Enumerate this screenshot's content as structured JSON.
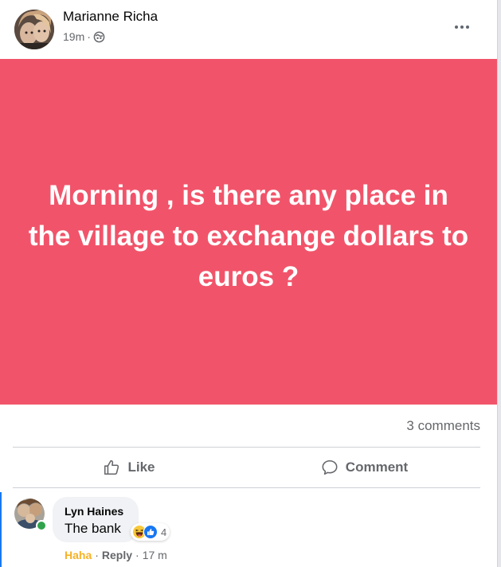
{
  "post": {
    "author": "Marianne Richa",
    "time": "19m",
    "separator": "·",
    "audience_icon": "globe-icon",
    "more_icon": "more-options-icon",
    "background_color": "#f1546a",
    "text": "Morning , is there any place in the village to exchange dollars to euros ?"
  },
  "stats": {
    "comments": "3 comments"
  },
  "actions": {
    "like_label": "Like",
    "like_icon": "thumbs-up-icon",
    "comment_label": "Comment",
    "comment_icon": "speech-bubble-icon"
  },
  "comment": {
    "author": "Lyn Haines",
    "text": "The bank",
    "online": true,
    "reaction_icons": [
      "haha-icon",
      "like-icon"
    ],
    "reaction_count": "4",
    "my_reaction": "Haha",
    "reply_label": "Reply",
    "separator": "·",
    "time": "17 m"
  },
  "colors": {
    "accent": "#1877f2",
    "haha": "#f7b125",
    "online": "#31a24c"
  }
}
